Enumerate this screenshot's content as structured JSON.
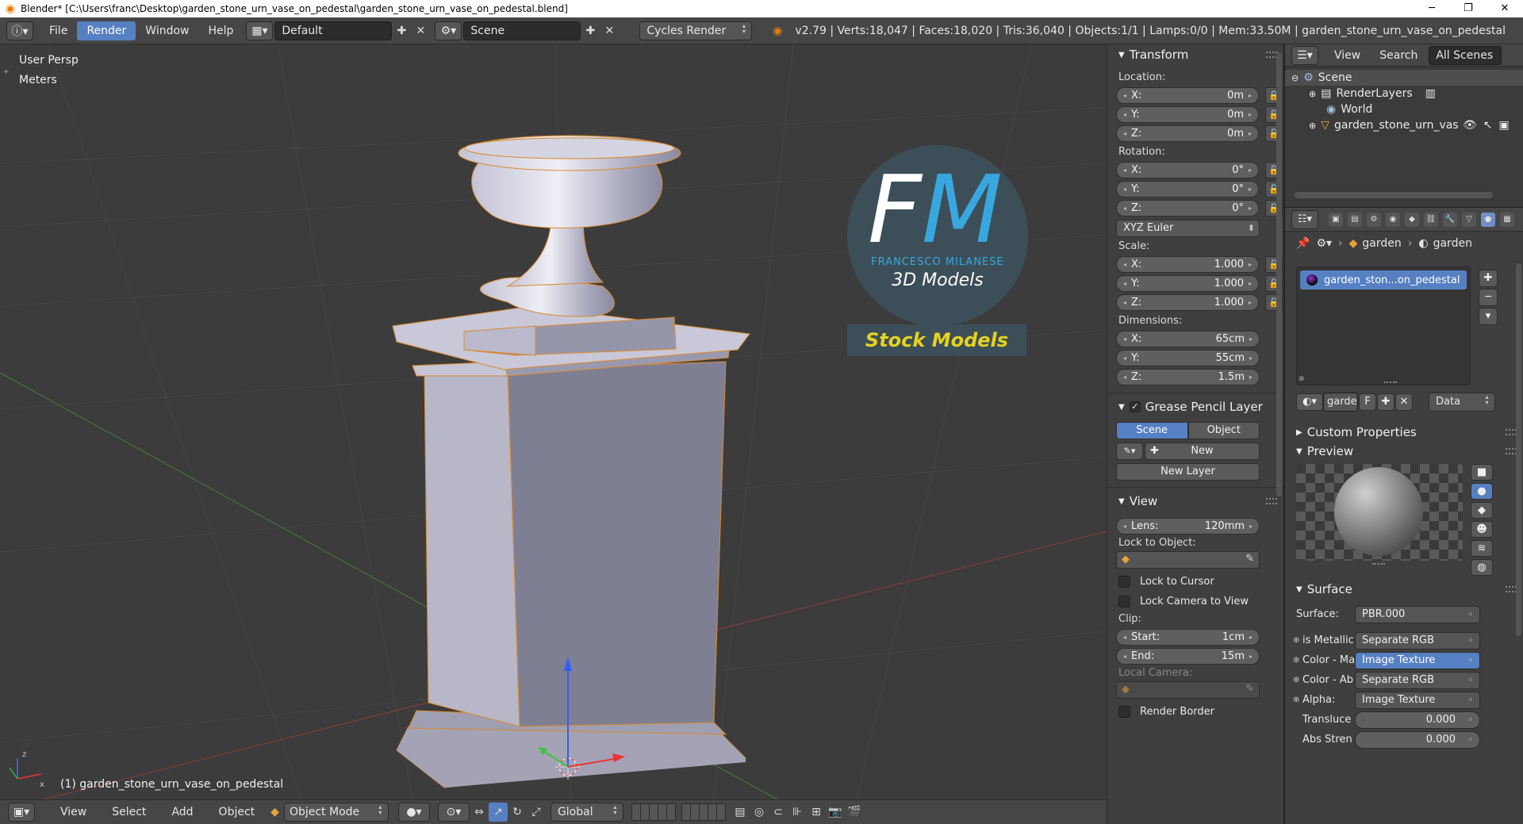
{
  "title_bar": {
    "title": "Blender* [C:\\Users\\franc\\Desktop\\garden_stone_urn_vase_on_pedestal\\garden_stone_urn_vase_on_pedestal.blend]",
    "minimize": "─",
    "maximize": "❐",
    "close": "✕"
  },
  "header": {
    "menus": [
      "File",
      "Render",
      "Window",
      "Help"
    ],
    "active_menu": "Render",
    "layout_name": "Default",
    "scene_name": "Scene",
    "render_engine": "Cycles Render",
    "stats": "v2.79 | Verts:18,047 | Faces:18,020 | Tris:36,040 | Objects:1/1 | Lamps:0/0 | Mem:33.50M | garden_stone_urn_vase_on_pedestal"
  },
  "viewport": {
    "view_name": "User Persp",
    "units": "Meters",
    "object_label": "(1) garden_stone_urn_vase_on_pedestal",
    "watermark": {
      "initials_f": "F",
      "initials_m": "M",
      "brand": "FRANCESCO MILANESE",
      "subtitle": "3D Models",
      "banner": "Stock Models"
    }
  },
  "bottom_bar": {
    "menus": [
      "View",
      "Select",
      "Add",
      "Object"
    ],
    "mode": "Object Mode",
    "orientation": "Global"
  },
  "n_panel": {
    "transform": {
      "title": "Transform",
      "location_label": "Location:",
      "location": [
        {
          "axis": "X:",
          "value": "0m"
        },
        {
          "axis": "Y:",
          "value": "0m"
        },
        {
          "axis": "Z:",
          "value": "0m"
        }
      ],
      "rotation_label": "Rotation:",
      "rotation": [
        {
          "axis": "X:",
          "value": "0°"
        },
        {
          "axis": "Y:",
          "value": "0°"
        },
        {
          "axis": "Z:",
          "value": "0°"
        }
      ],
      "rotation_mode": "XYZ Euler",
      "scale_label": "Scale:",
      "scale": [
        {
          "axis": "X:",
          "value": "1.000"
        },
        {
          "axis": "Y:",
          "value": "1.000"
        },
        {
          "axis": "Z:",
          "value": "1.000"
        }
      ],
      "dimensions_label": "Dimensions:",
      "dimensions": [
        {
          "axis": "X:",
          "value": "65cm"
        },
        {
          "axis": "Y:",
          "value": "55cm"
        },
        {
          "axis": "Z:",
          "value": "1.5m"
        }
      ]
    },
    "grease_pencil": {
      "title": "Grease Pencil Layer",
      "tab_scene": "Scene",
      "tab_object": "Object",
      "new_label": "New",
      "new_layer_label": "New Layer"
    },
    "view": {
      "title": "View",
      "lens_label": "Lens:",
      "lens_value": "120mm",
      "lock_object_label": "Lock to Object:",
      "lock_cursor": "Lock to Cursor",
      "lock_camera": "Lock Camera to View",
      "clip_label": "Clip:",
      "clip_start_label": "Start:",
      "clip_start": "1cm",
      "clip_end_label": "End:",
      "clip_end": "15m",
      "local_camera": "Local Camera:",
      "render_border": "Render Border"
    }
  },
  "outliner": {
    "view": "View",
    "search": "Search",
    "filter": "All Scenes",
    "items": [
      {
        "label": "Scene"
      },
      {
        "label": "RenderLayers"
      },
      {
        "label": "World"
      },
      {
        "label": "garden_stone_urn_vas"
      }
    ]
  },
  "properties": {
    "breadcrumb_1": "garden",
    "breadcrumb_2": "garden",
    "material_slot": "garden_ston...on_pedestal",
    "material_name": "garde",
    "fake_user": "F",
    "link_type": "Data",
    "custom_props": "Custom Properties",
    "preview": "Preview",
    "surface_title": "Surface",
    "surface_label": "Surface:",
    "surface_value": "PBR.000",
    "inputs": [
      {
        "label": "is Metallic",
        "value": "Separate RGB"
      },
      {
        "label": "Color - Ma",
        "value": "Image Texture"
      },
      {
        "label": "Color - Ab",
        "value": "Separate RGB"
      },
      {
        "label": "Alpha:",
        "value": "Image Texture"
      },
      {
        "label": "Transluce",
        "value": "0.000"
      },
      {
        "label": "Abs Stren",
        "value": "0.000"
      }
    ]
  }
}
